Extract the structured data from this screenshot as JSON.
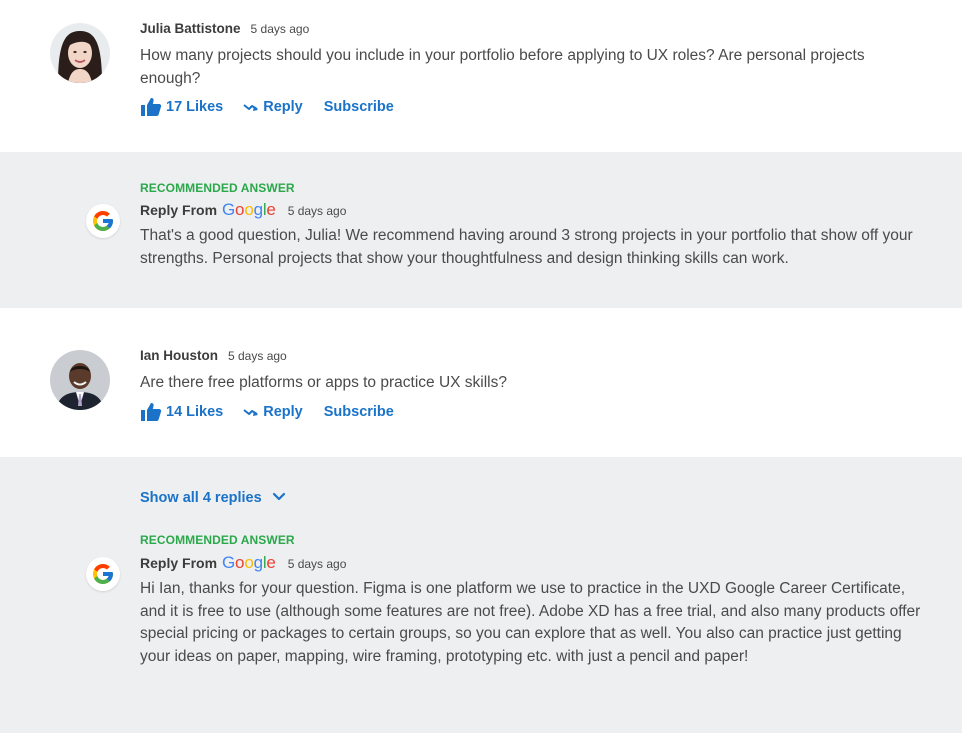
{
  "threads": [
    {
      "question": {
        "author": "Julia Battistone",
        "time": "5 days ago",
        "text": "How many projects should you include in your portfolio before applying to UX roles? Are personal projects enough?",
        "likes": "17 Likes",
        "reply_label": "Reply",
        "subscribe_label": "Subscribe"
      },
      "answer": {
        "badge": "RECOMMENDED ANSWER",
        "reply_from": "Reply From",
        "brand": "Google",
        "time": "5 days ago",
        "text": "That's a good question, Julia! We recommend having around 3 strong projects in your portfolio that show off your strengths. Personal projects that show your thoughtfulness and design thinking skills can work."
      }
    },
    {
      "question": {
        "author": "Ian Houston",
        "time": "5 days ago",
        "text": "Are there free platforms or apps to practice UX skills?",
        "likes": "14 Likes",
        "reply_label": "Reply",
        "subscribe_label": "Subscribe"
      },
      "show_all": "Show all 4 replies",
      "answer": {
        "badge": "RECOMMENDED ANSWER",
        "reply_from": "Reply From",
        "brand": "Google",
        "time": "5 days ago",
        "text": "Hi Ian, thanks for your question. Figma is one platform we use to practice in the UXD Google Career Certificate, and it is free to use (although some features are not free). Adobe XD has a free trial, and also many products offer special pricing or packages to certain groups, so you can explore that as well. You also can practice just getting your ideas on paper, mapping, wire framing, prototyping etc. with just a pencil and paper!"
      }
    }
  ],
  "colors": {
    "link": "#1a73c9",
    "recommended": "#2aa84a",
    "answer_bg": "#eeeff1"
  },
  "icons": [
    "thumbs-up-icon",
    "reply-arrow-icon",
    "chevron-down-icon",
    "google-g-logo"
  ]
}
